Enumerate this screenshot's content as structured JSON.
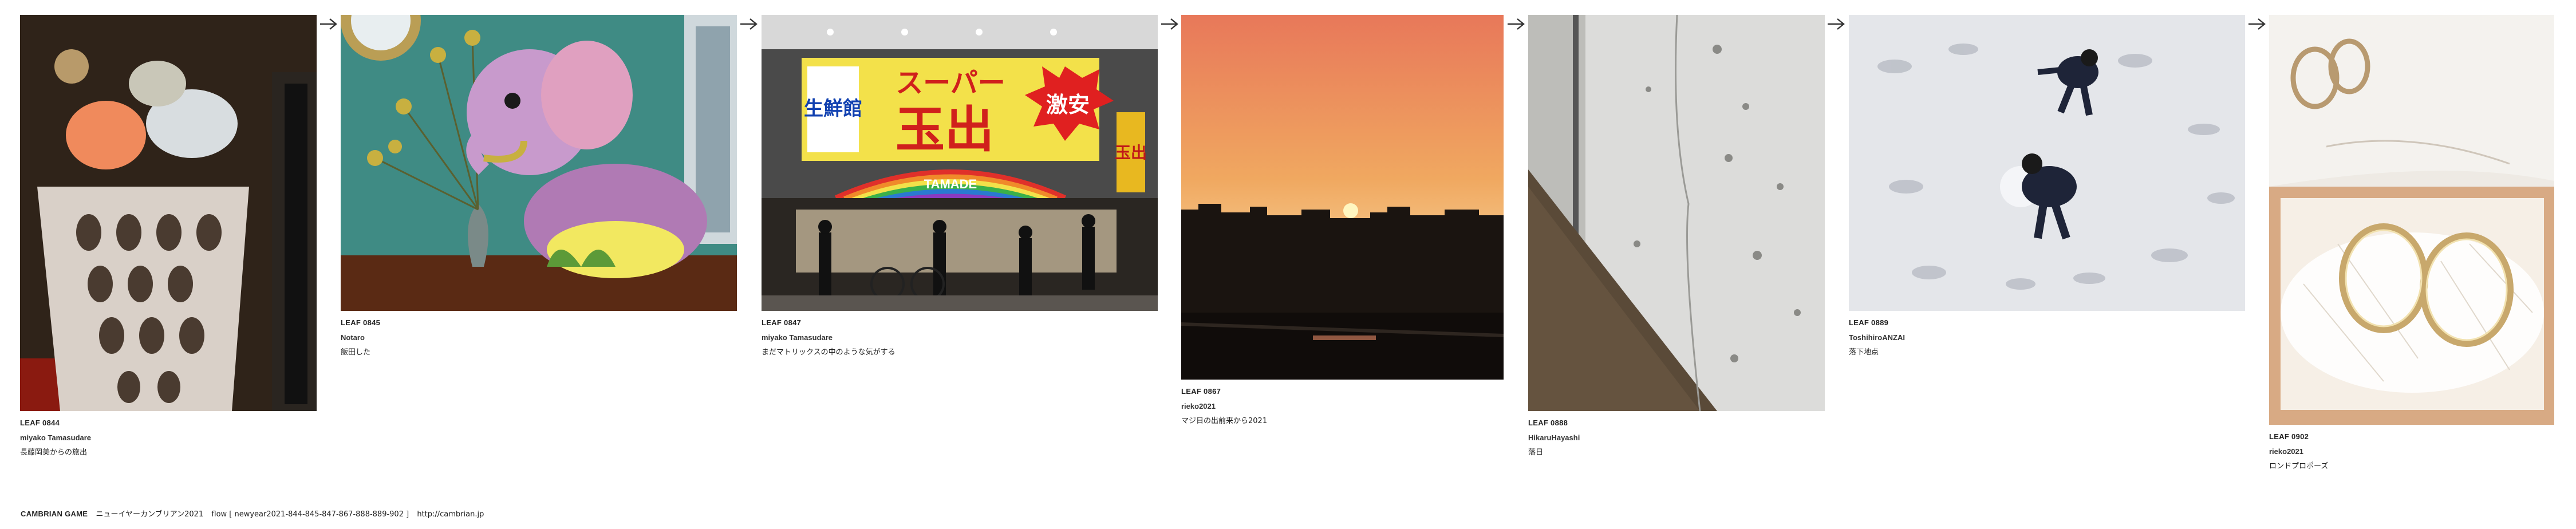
{
  "leaves": [
    {
      "id": "LEAF 0844",
      "author": "miyako Tamasudare",
      "title": "長藤岡美からの旅出"
    },
    {
      "id": "LEAF 0845",
      "author": "Notaro",
      "title": "飯田した"
    },
    {
      "id": "LEAF 0847",
      "author": "miyako Tamasudare",
      "title": "まだマトリックスの中のような気がする",
      "sign": {
        "top_left": "生鮮館",
        "top_mid": "スーパー",
        "big": "玉出",
        "badge": "激安",
        "banner": "TAMADE",
        "side": "玉出"
      }
    },
    {
      "id": "LEAF 0867",
      "author": "rieko2021",
      "title": "マジ日の出前来から2021"
    },
    {
      "id": "LEAF 0888",
      "author": "HikaruHayashi",
      "title": "落日"
    },
    {
      "id": "LEAF 0889",
      "author": "ToshihiroANZAI",
      "title": "落下地点"
    },
    {
      "id": "LEAF 0902",
      "author": "rieko2021",
      "title": "ロンドプロポーズ"
    }
  ],
  "arrow_icon": "right-arrow-icon",
  "footer": {
    "brand": "CAMBRIAN GAME",
    "name": "ニューイヤーカンブリアン2021",
    "flow": "flow [ newyear2021-844-845-847-867-888-889-902 ]",
    "url": "http://cambrian.jp"
  }
}
